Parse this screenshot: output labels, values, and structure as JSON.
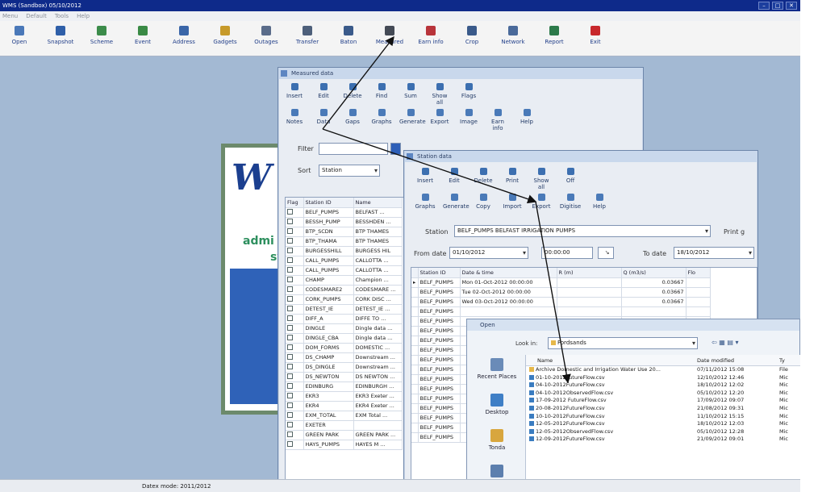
{
  "app": {
    "title": "WMS (Sandbox) 05/10/2012",
    "menu": [
      "Menu",
      "Default",
      "Tools",
      "Help"
    ],
    "toolbar": [
      {
        "label": "Open",
        "icon": "open-icon",
        "color": "#4a78b8"
      },
      {
        "label": "Snapshot",
        "icon": "snapshot-icon",
        "color": "#2f5fa8"
      },
      {
        "label": "Scheme",
        "icon": "scheme-icon",
        "color": "#3c8c4a"
      },
      {
        "label": "Event",
        "icon": "event-icon",
        "color": "#3a8a45"
      },
      {
        "label": "Address",
        "icon": "address-icon",
        "color": "#3a66a8"
      },
      {
        "label": "Gadgets",
        "icon": "gadgets-icon",
        "color": "#c79a2a"
      },
      {
        "label": "Outages",
        "icon": "outages-icon",
        "color": "#5a6c8a"
      },
      {
        "label": "Transfer",
        "icon": "transfer-icon",
        "color": "#4d5f7a"
      },
      {
        "label": "Baton",
        "icon": "baton-icon",
        "color": "#3a5a8a"
      },
      {
        "label": "Measured",
        "icon": "measured-icon",
        "color": "#444a55"
      },
      {
        "label": "Earn info",
        "icon": "earn-info-icon",
        "color": "#b8343a"
      },
      {
        "label": "Crop",
        "icon": "crop-icon",
        "color": "#3a5a8a"
      },
      {
        "label": "Network",
        "icon": "network-icon",
        "color": "#4a6a9a"
      },
      {
        "label": "Report",
        "icon": "report-icon",
        "color": "#2d7a4a"
      },
      {
        "label": "Exit",
        "icon": "exit-icon",
        "color": "#c8282c"
      }
    ],
    "status_text": "Datex mode: 2011/2012",
    "window_controls": [
      "–",
      "□",
      "✕"
    ]
  },
  "splash": {
    "big_letter": "W",
    "line1": "admi",
    "line2": "sy"
  },
  "win1": {
    "title": "Measured data",
    "toolbar1": [
      "Insert",
      "Edit",
      "Delete",
      "Find",
      "Sum",
      "Show all",
      "Flags"
    ],
    "toolbar2": [
      "Notes",
      "Data",
      "Gaps",
      "Graphs",
      "Generate",
      "Export",
      "Image",
      "Earn info",
      "Help"
    ],
    "filter_label": "Filter",
    "sort_label": "Sort",
    "sort_value": "Station",
    "columns": [
      "Flag",
      "Station ID",
      "Name"
    ],
    "rows": [
      [
        "BELF_PUMPS",
        "BELFAST ..."
      ],
      [
        "BESSH_PUMP",
        "BESSHDEN ..."
      ],
      [
        "BTP_SCDN",
        "BTP THAMES"
      ],
      [
        "BTP_THAMA",
        "BTP THAMES"
      ],
      [
        "BURGESSHILL",
        "BURGESS HIL"
      ],
      [
        "CALL_PUMPS",
        "CALLOTTA ..."
      ],
      [
        "CALL_PUMPS",
        "CALLOTTA ..."
      ],
      [
        "CHAMP",
        "Champion ..."
      ],
      [
        "CODESMARE2",
        "CODESMARE ..."
      ],
      [
        "CORK_PUMPS",
        "CORK DISC ..."
      ],
      [
        "DETEST_IE",
        "DETEST_IE ..."
      ],
      [
        "DIFF_A",
        "DIFFE TO ..."
      ],
      [
        "DINGLE",
        "Dingle data ..."
      ],
      [
        "DINGLE_CBA",
        "Dingle data ..."
      ],
      [
        "DOM_FORMS",
        "DOMESTIC ..."
      ],
      [
        "DS_CHAMP",
        "Downstream ..."
      ],
      [
        "DS_DINGLE",
        "Downstream ..."
      ],
      [
        "DS_NEWTON",
        "DS NEWTON ..."
      ],
      [
        "EDINBURG",
        "EDINBURGH ..."
      ],
      [
        "EKR3",
        "EKR3 Exeter ..."
      ],
      [
        "EKR4",
        "EKR4 Exeter ..."
      ],
      [
        "EXM_TOTAL",
        "EXM Total ..."
      ],
      [
        "EXETER",
        ""
      ],
      [
        "GREEN PARK",
        "GREEN PARK ..."
      ],
      [
        "HAYS_PUMPS",
        "HAYES M ..."
      ]
    ]
  },
  "win2": {
    "title": "Station data",
    "toolbar1": [
      "Insert",
      "Edit",
      "Delete",
      "Print",
      "Show all",
      "Off"
    ],
    "toolbar2": [
      "Graphs",
      "Generate",
      "Copy",
      "Import",
      "Export",
      "Digitise",
      "Help"
    ],
    "station_label": "Station",
    "station_value": "BELF_PUMPS  BELFAST IRRIGATION PUMPS",
    "print_label": "Print g",
    "from_label": "From date",
    "from_value": "01/10/2012",
    "time_value": "00:00:00",
    "to_label": "To date",
    "to_value": "18/10/2012",
    "columns": [
      "Station ID",
      "Date & time",
      "R (m)",
      "Q (m3/s)",
      "Flo"
    ],
    "rows": [
      [
        "BELF_PUMPS",
        "Mon 01-Oct-2012 00:00:00",
        "",
        "0.03667"
      ],
      [
        "BELF_PUMPS",
        "Tue 02-Oct-2012 00:00:00",
        "",
        "0.03667"
      ],
      [
        "BELF_PUMPS",
        "Wed 03-Oct-2012 00:00:00",
        "",
        "0.03667"
      ],
      [
        "BELF_PUMPS",
        "",
        "",
        ""
      ],
      [
        "BELF_PUMPS",
        "",
        "",
        ""
      ],
      [
        "BELF_PUMPS",
        "",
        "",
        ""
      ],
      [
        "BELF_PUMPS",
        "",
        "",
        ""
      ],
      [
        "BELF_PUMPS",
        "",
        "",
        ""
      ],
      [
        "BELF_PUMPS",
        "",
        "",
        ""
      ],
      [
        "BELF_PUMPS",
        "",
        "",
        ""
      ],
      [
        "BELF_PUMPS",
        "",
        "",
        ""
      ],
      [
        "BELF_PUMPS",
        "",
        "",
        ""
      ],
      [
        "BELF_PUMPS",
        "",
        "",
        ""
      ],
      [
        "BELF_PUMPS",
        "",
        "",
        ""
      ],
      [
        "BELF_PUMPS",
        "",
        "",
        ""
      ],
      [
        "BELF_PUMPS",
        "",
        "",
        ""
      ],
      [
        "BELF_PUMPS",
        "",
        "",
        ""
      ]
    ]
  },
  "opendlg": {
    "title": "Open",
    "lookin_label": "Look in:",
    "lookin_value": "Fordsands",
    "columns": [
      "Name",
      "Date modified",
      "Ty"
    ],
    "places": [
      "Recent Places",
      "Desktop",
      "Tonda",
      "Computer"
    ],
    "files": [
      [
        "Archive Domestic and Irrigation Water Use 20...",
        "07/11/2012 15:08",
        "File"
      ],
      [
        "01-10-2012FutureFlow.csv",
        "12/10/2012 12:46",
        "Mic"
      ],
      [
        "04-10-2012FutureFlow.csv",
        "18/10/2012 12:02",
        "Mic"
      ],
      [
        "04-10-2012ObservedFlow.csv",
        "05/10/2012 12:20",
        "Mic"
      ],
      [
        "17-09-2012 FutureFlow.csv",
        "17/09/2012 09:07",
        "Mic"
      ],
      [
        "20-08-2012FutureFlow.csv",
        "21/08/2012 09:31",
        "Mic"
      ],
      [
        "10-10-2012FutureFlow.csv",
        "11/10/2012 15:15",
        "Mic"
      ],
      [
        "12-05-2012FutureFlow.csv",
        "18/10/2012 12:03",
        "Mic"
      ],
      [
        "12-05-2012ObservedFlow.csv",
        "05/10/2012 12:28",
        "Mic"
      ],
      [
        "12-09-2012FutureFlow.csv",
        "21/09/2012 09:01",
        "Mic"
      ]
    ]
  }
}
